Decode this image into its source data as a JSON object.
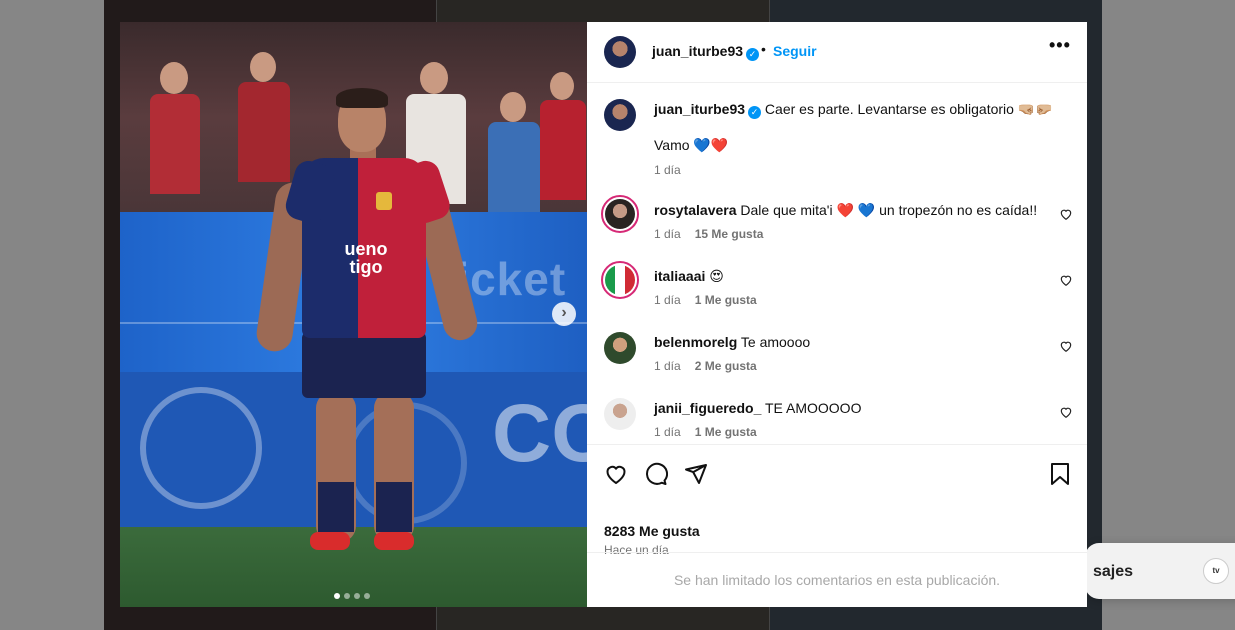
{
  "background": {
    "messages_label": "sajes",
    "messages_avatar_text": "tv"
  },
  "media": {
    "sponsor_line1": "ueno",
    "sponsor_line2": "tigo",
    "banner_text": "ticket",
    "wall_text": "CO",
    "next_icon": "chevron-right-icon",
    "carousel_dots": 4,
    "carousel_active": 1
  },
  "header": {
    "username": "juan_iturbe93",
    "separator": "•",
    "follow_label": "Seguir",
    "more_icon": "•••"
  },
  "caption": {
    "username": "juan_iturbe93",
    "text": "Caer es parte. Levantarse es obligatorio 🤜🏼🤛🏼",
    "text2": "Vamo 💙❤️",
    "time": "1 día"
  },
  "comments": [
    {
      "username": "rosytalavera",
      "text": "Dale que mita'i ❤️ 💙 un tropezón no es caída!!",
      "time": "1 día",
      "likes": "15 Me gusta"
    },
    {
      "username": "italiaaai",
      "text": "😍",
      "time": "1 día",
      "likes": "1 Me gusta"
    },
    {
      "username": "belenmorelg",
      "text": "Te amoooo",
      "time": "1 día",
      "likes": "2 Me gusta"
    },
    {
      "username": "janii_figueredo_",
      "text": "TE AMOOOOO",
      "time": "1 día",
      "likes": "1 Me gusta"
    }
  ],
  "footer": {
    "likes_count": "8283 Me gusta",
    "time_ago": "Hace un día",
    "limited_notice": "Se han limitado los comentarios en esta publicación."
  },
  "colors": {
    "accent": "#0095f6",
    "shirt_blue": "#1c2c6b",
    "shirt_red": "#c0203a"
  }
}
